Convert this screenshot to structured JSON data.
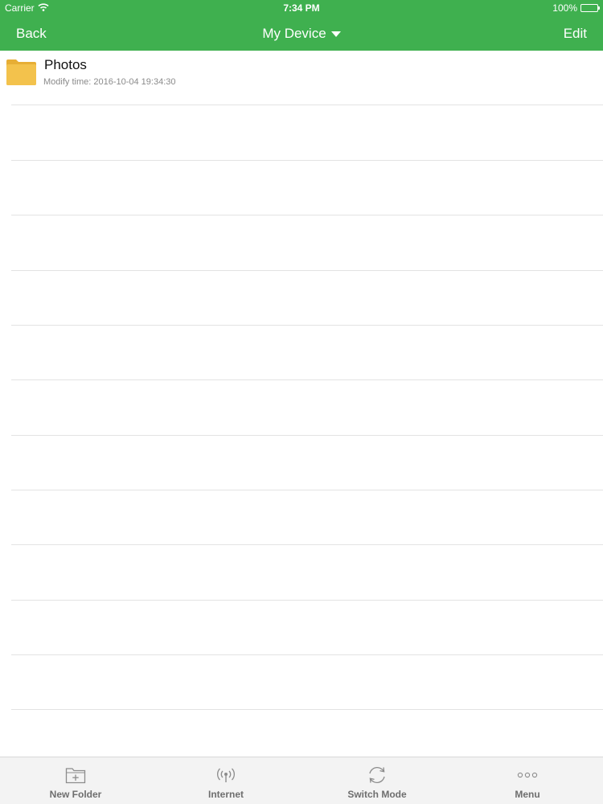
{
  "status_bar": {
    "carrier": "Carrier",
    "time": "7:34 PM",
    "battery": "100%"
  },
  "nav": {
    "back_label": "Back",
    "title": "My Device",
    "edit_label": "Edit"
  },
  "files": [
    {
      "name": "Photos",
      "meta": "Modify time: 2016-10-04 19:34:30",
      "icon": "folder-icon"
    }
  ],
  "toolbar": {
    "new_folder": "New Folder",
    "internet": "Internet",
    "switch_mode": "Switch Mode",
    "menu": "Menu"
  },
  "colors": {
    "nav_background": "#3fb04f",
    "folder": "#f3c24c",
    "tab_label": "#6e6e6e"
  }
}
